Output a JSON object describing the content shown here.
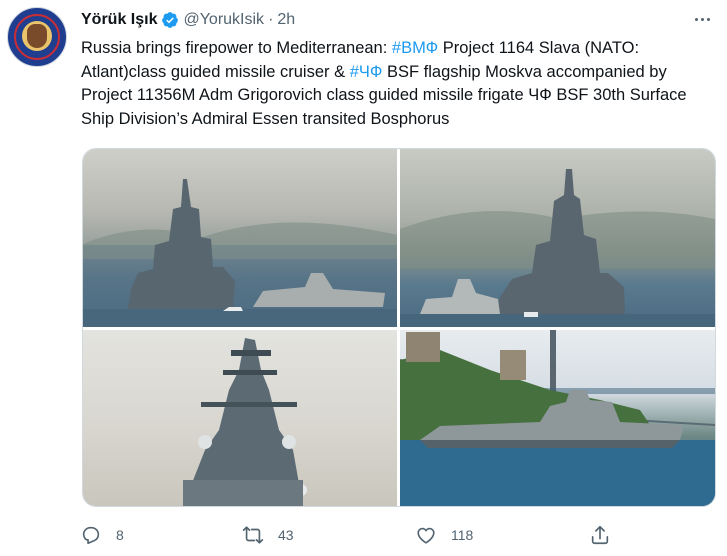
{
  "user": {
    "name": "Yörük Işık",
    "handle": "@YorukIsik",
    "separator": "·",
    "time": "2h"
  },
  "tweet": {
    "t1": "Russia brings firepower to Mediterranean: ",
    "h1": "#ВМФ",
    "t2": " Project 1164 Slava (NATO: Atlant)class guided missile cruiser & ",
    "h2": "#ЧФ",
    "t3": " BSF flagship Moskva accompanied by Project 11356M Adm Grigorovich class guided missile frigate ЧФ BSF 30th Surface Ship Division’s Admiral Essen transited  Bosphorus"
  },
  "media": {
    "images": [
      "warship-photo",
      "warship-photo",
      "warship-mast-photo",
      "bosphorus-frigate-photo"
    ]
  },
  "actions": {
    "reply_count": "8",
    "retweet_count": "43",
    "like_count": "118"
  },
  "icons": [
    "verified-badge-icon",
    "more-icon",
    "reply-icon",
    "retweet-icon",
    "like-icon",
    "share-icon"
  ],
  "colors": {
    "link": "#1d9bf0",
    "muted": "#536471",
    "text": "#0f1419"
  }
}
